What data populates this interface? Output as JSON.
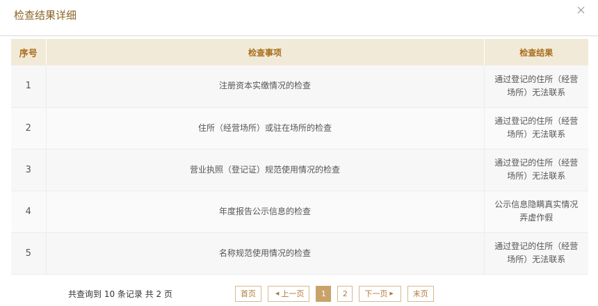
{
  "dialog": {
    "title": "检查结果详细"
  },
  "table": {
    "headers": {
      "no": "序号",
      "item": "检查事项",
      "result": "检查结果"
    },
    "rows": [
      {
        "no": "1",
        "item": "注册资本实缴情况的检查",
        "result": "通过登记的住所（经营场所）无法联系"
      },
      {
        "no": "2",
        "item": "住所（经营场所）或驻在场所的检查",
        "result": "通过登记的住所（经营场所）无法联系"
      },
      {
        "no": "3",
        "item": "营业执照（登记证）规范使用情况的检查",
        "result": "通过登记的住所（经营场所）无法联系"
      },
      {
        "no": "4",
        "item": "年度报告公示信息的检查",
        "result": "公示信息隐瞒真实情况弄虚作假"
      },
      {
        "no": "5",
        "item": "名称规范使用情况的检查",
        "result": "通过登记的住所（经营场所）无法联系"
      }
    ]
  },
  "footer": {
    "summary": "共查询到 10 条记录 共 2 页"
  },
  "pagination": {
    "first": "首页",
    "prev": "上一页",
    "pages": [
      "1",
      "2"
    ],
    "current": "1",
    "next": "下一页",
    "last": "末页"
  },
  "icons": {
    "close": "close-icon",
    "prev": "triangle-left-icon",
    "next": "triangle-right-icon"
  },
  "colors": {
    "title": "#8a6224",
    "header_bg": "#f2ead8",
    "header_text": "#a86e1c",
    "pager_border": "#d8b690",
    "pager_active": "#c8a268"
  }
}
